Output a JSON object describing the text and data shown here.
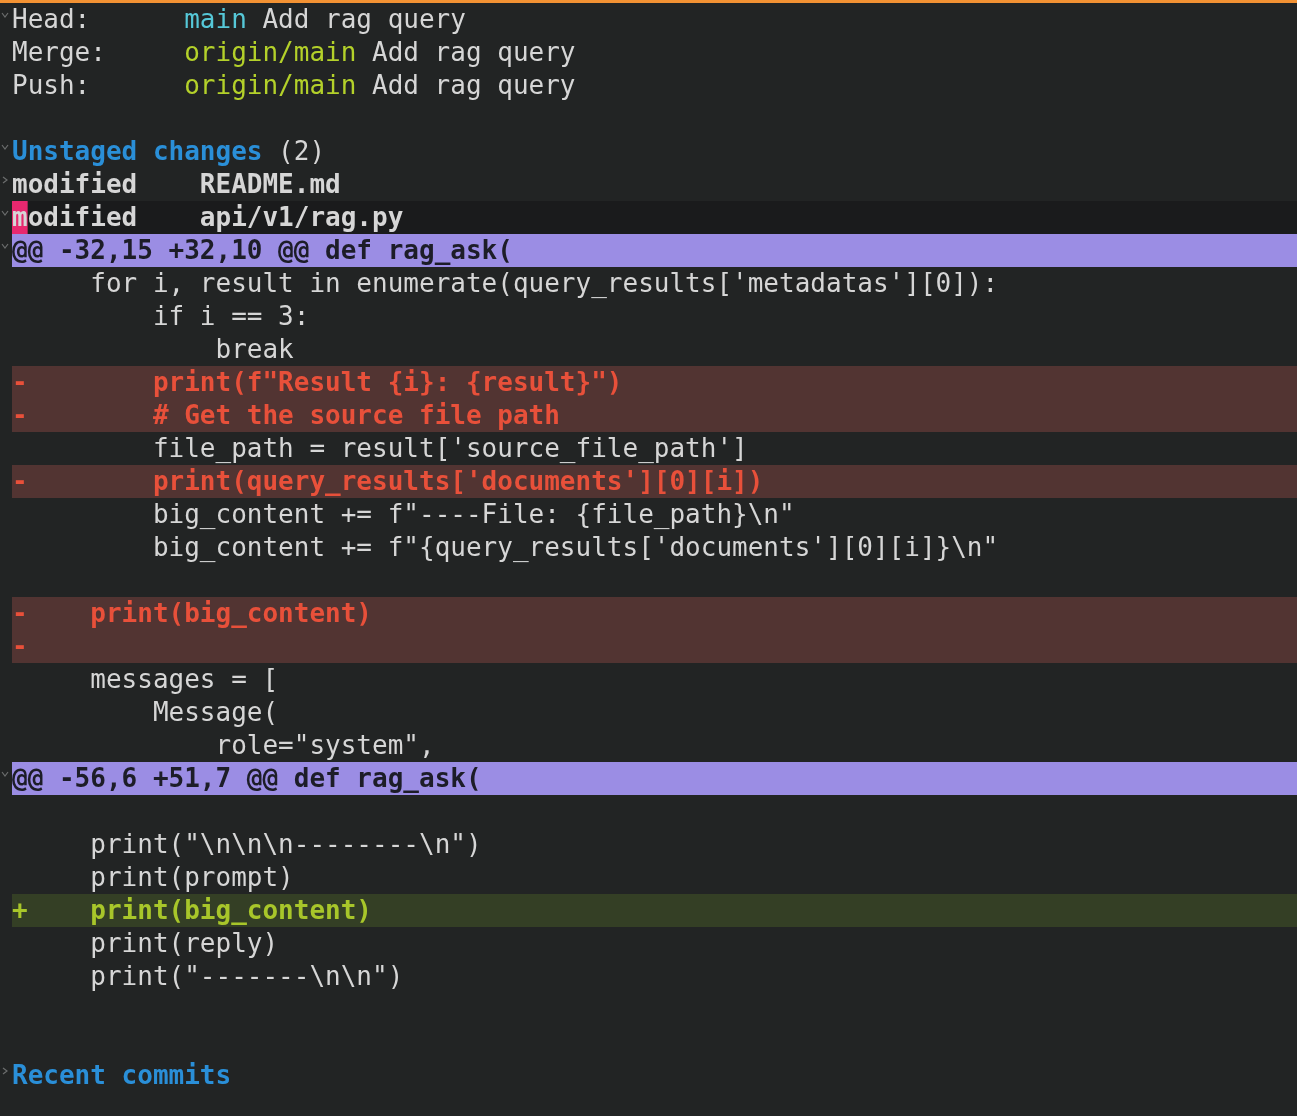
{
  "refs": [
    {
      "label": "Head:",
      "ref": "main",
      "color": "#56c8d8",
      "message": "Add rag query",
      "expanded": true
    },
    {
      "label": "Merge:",
      "ref": "origin/main",
      "color": "#b4d12a",
      "message": "Add rag query"
    },
    {
      "label": "Push:",
      "ref": "origin/main",
      "color": "#b4d12a",
      "message": "Add rag query"
    }
  ],
  "unstaged": {
    "title": "Unstaged changes",
    "count": "(2)",
    "expanded": true,
    "files": [
      {
        "status": "modified",
        "path": "README.md",
        "expanded": false,
        "selected": false
      },
      {
        "status": "modified",
        "path": "api/v1/rag.py",
        "expanded": true,
        "selected": true
      }
    ]
  },
  "hunks": [
    {
      "header": "@@ -32,15 +32,10 @@ def rag_ask(",
      "expanded": true,
      "lines": [
        {
          "kind": "context",
          "text": "     for i, result in enumerate(query_results['metadatas'][0]):"
        },
        {
          "kind": "context",
          "text": "         if i == 3:"
        },
        {
          "kind": "context",
          "text": "             break"
        },
        {
          "kind": "removed",
          "text": "-        print(f\"Result {i}: {result}\")"
        },
        {
          "kind": "removed",
          "text": "-        # Get the source file path"
        },
        {
          "kind": "context",
          "text": "         file_path = result['source_file_path']"
        },
        {
          "kind": "removed",
          "text": "-        print(query_results['documents'][0][i])"
        },
        {
          "kind": "context",
          "text": "         big_content += f\"----File: {file_path}\\n\""
        },
        {
          "kind": "context",
          "text": "         big_content += f\"{query_results['documents'][0][i]}\\n\""
        },
        {
          "kind": "blank"
        },
        {
          "kind": "removed",
          "text": "-    print(big_content)"
        },
        {
          "kind": "removed",
          "text": "-"
        },
        {
          "kind": "context",
          "text": "     messages = ["
        },
        {
          "kind": "context",
          "text": "         Message("
        },
        {
          "kind": "context",
          "text": "             role=\"system\","
        }
      ]
    },
    {
      "header": "@@ -56,6 +51,7 @@ def rag_ask(",
      "expanded": true,
      "lines": [
        {
          "kind": "blank"
        },
        {
          "kind": "context",
          "text": "     print(\"\\n\\n\\n--------\\n\")"
        },
        {
          "kind": "context",
          "text": "     print(prompt)"
        },
        {
          "kind": "added",
          "text": "+    print(big_content)"
        },
        {
          "kind": "context",
          "text": "     print(reply)"
        },
        {
          "kind": "context",
          "text": "     print(\"-------\\n\\n\")"
        }
      ]
    }
  ],
  "recent": {
    "title": "Recent commits",
    "expanded": false
  }
}
